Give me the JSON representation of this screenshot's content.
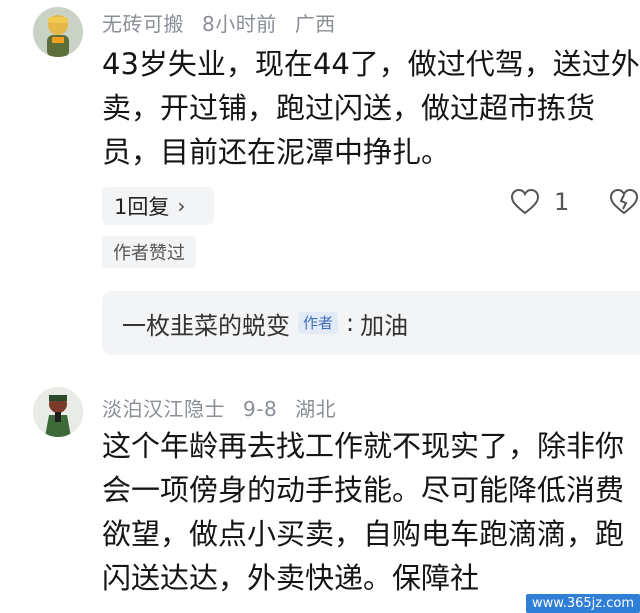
{
  "comments": [
    {
      "username": "无砖可搬",
      "time": "8小时前",
      "location": "广西",
      "text": "43岁失业，现在44了，做过代驾，送过外卖，开过铺，跑过闪送，做过超市拣货员，目前还在泥潭中挣扎。",
      "replies_label": "1回复",
      "like_count": "1",
      "author_liked": "作者赞过",
      "reply": {
        "username": "一枚韭菜的蜕变",
        "badge": "作者",
        "text": "加油"
      }
    },
    {
      "username": "淡泊汉江隐士",
      "time": "9-8",
      "location": "湖北",
      "text": "这个年龄再去找工作就不现实了，除非你会一项傍身的动手技能。尽可能降低消费欲望，做点小买卖，自购电车跑滴滴，跑闪送达达，外卖快递。保障社"
    }
  ],
  "watermark": "www.365jz.com"
}
